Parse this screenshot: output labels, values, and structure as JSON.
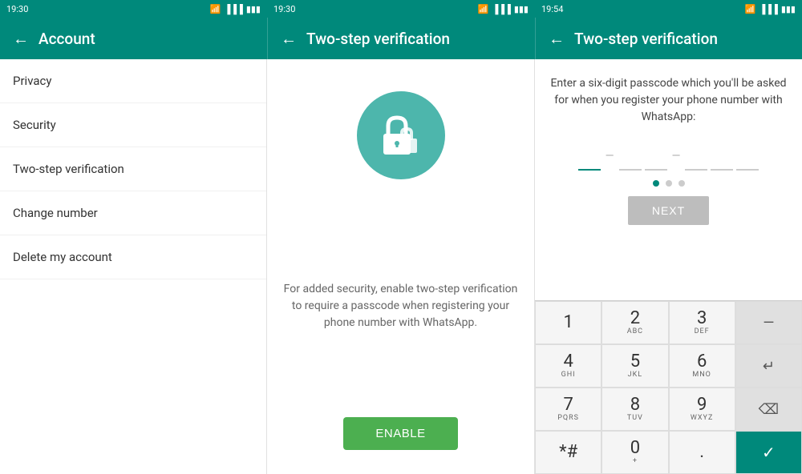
{
  "panels": {
    "left": {
      "status_time": "19:30",
      "app_bar_title": "Account",
      "menu_items": [
        {
          "label": "Privacy",
          "id": "privacy"
        },
        {
          "label": "Security",
          "id": "security"
        },
        {
          "label": "Two-step verification",
          "id": "two-step"
        },
        {
          "label": "Change number",
          "id": "change-number"
        },
        {
          "label": "Delete my account",
          "id": "delete-account"
        }
      ]
    },
    "mid": {
      "status_time": "19:30",
      "app_bar_back": "←",
      "app_bar_title": "Two-step verification",
      "description": "For added security, enable two-step verification to require a passcode when registering your phone number with WhatsApp.",
      "enable_button": "ENABLE"
    },
    "right": {
      "status_time": "19:54",
      "app_bar_back": "←",
      "app_bar_title": "Two-step verification",
      "description": "Enter a six-digit passcode which you'll be asked for when you register your phone number with WhatsApp:",
      "next_button": "NEXT",
      "dots": [
        {
          "active": true
        },
        {
          "active": false
        },
        {
          "active": false
        }
      ],
      "numpad": [
        {
          "num": "1",
          "letters": "",
          "type": "number"
        },
        {
          "num": "2",
          "letters": "ABC",
          "type": "number"
        },
        {
          "num": "3",
          "letters": "DEF",
          "type": "number"
        },
        {
          "num": "—",
          "letters": "",
          "type": "action"
        },
        {
          "num": "4",
          "letters": "GHI",
          "type": "number"
        },
        {
          "num": "5",
          "letters": "JKL",
          "type": "number"
        },
        {
          "num": "6",
          "letters": "MNO",
          "type": "number"
        },
        {
          "num": "⏎",
          "letters": "",
          "type": "action"
        },
        {
          "num": "7",
          "letters": "PQRS",
          "type": "number"
        },
        {
          "num": "8",
          "letters": "TUV",
          "type": "number"
        },
        {
          "num": "9",
          "letters": "WXYZ",
          "type": "number"
        },
        {
          "num": "⌫",
          "letters": "",
          "type": "backspace"
        },
        {
          "num": "*#",
          "letters": "",
          "type": "special"
        },
        {
          "num": "0",
          "letters": "+",
          "type": "number"
        },
        {
          "num": ".",
          "letters": "",
          "type": "special"
        },
        {
          "num": "✓",
          "letters": "",
          "type": "confirm"
        }
      ]
    }
  }
}
